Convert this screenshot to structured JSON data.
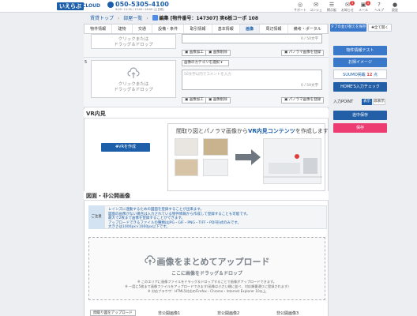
{
  "header": {
    "logo": "いえらぶ",
    "logo_sub": "CLOUD",
    "phone": "050-5305-4100",
    "phone_hours": "9:00~11:30 / 13:00~18:00 (土日祝)",
    "icons": [
      {
        "name": "support-icon",
        "label": "サポート",
        "glyph": "◎"
      },
      {
        "name": "concierge-icon",
        "label": "コンシェ",
        "glyph": "✉"
      },
      {
        "name": "forum-icon",
        "label": "掲示板",
        "glyph": "☰"
      },
      {
        "name": "notice-icon",
        "label": "お知らせ",
        "glyph": "✉",
        "badge": "1"
      },
      {
        "name": "mail-icon",
        "label": "メール",
        "glyph": "▣",
        "badge": "1"
      },
      {
        "name": "help-icon",
        "label": "ヘルプ",
        "glyph": "?"
      },
      {
        "name": "user-icon",
        "label": "設定",
        "glyph": "●"
      }
    ]
  },
  "breadcrumb": {
    "items": [
      "賃貸トップ",
      "部屋一覧"
    ],
    "current": "編集 [物件番号：147307] 実6板コーポ 108"
  },
  "tabs": [
    "物件情報",
    "建物",
    "交通",
    "設備・条件",
    "取引情報",
    "基本情報",
    "画像",
    "周辺情報",
    "備考・ポータル"
  ],
  "active_tab": "画像",
  "upload_rows": {
    "row4_hint": "クリックまたは\nドラッグ＆ドロップ",
    "row4_count": "0 / 50文字",
    "row5_num": "5",
    "row5_hint": "クリックまたは\nドラッグ＆ドロップ",
    "category_placeholder": "画像のカテゴリを選択",
    "comment_placeholder": "50文字以内でコメントを入力",
    "row5_count": "0 / 50文字",
    "process_btn": "画像加工",
    "delete_btn": "画像削除",
    "panorama_btn": "パノラマ画像を",
    "panorama_btn_suffix": "登録"
  },
  "vr": {
    "title": "VR内見",
    "create_btn": "VRを作成",
    "banner_prefix": "間取り図とパノラマ画像から",
    "banner_strong": "VR内見コンテンツ",
    "banner_suffix": "を作成します"
  },
  "floorplan": {
    "title": "図面・非公開画像",
    "note_tag": "ご注意",
    "notes": [
      "レインズに連動するための図面を登録することが出来ます。",
      "図面の画像がない場合は入力されている物件情報から作成して登録することも可能です。",
      "最大で2枚まで画像を登録することができます。",
      "アップロードできるファイルの種類はJPG・GIF・PNG・TIFF・PDF形式のみです。",
      "大きさは1000px×1000px以下です。"
    ],
    "bulk_title": "画像をまとめてアップロード",
    "bulk_sub": "ここに画像をドラッグ＆ドロップ",
    "bulk_notes": [
      "※ このエリアに画像ファイルをドラッグ＆ドロップすることで画像がアップロードできます。",
      "※ 一度に5枚まで画像ファイルをアップロードできます(画像は小さい順に並べ、対応順番通りに登録されます)",
      "※ 対応ブラウザ：HTML5対応のFirefox・Chrome・Internet Explorer 10以上"
    ],
    "bottom_btn": "間取り図をアップロード",
    "captions": [
      "非公開画像1",
      "非公開画像2",
      "非公開画像3"
    ]
  },
  "sidebar": {
    "top_btn1": "タブの並び替えを保存",
    "top_btn2": "全て開く",
    "buttons": [
      "物件情報テスト",
      "お掃イメージ"
    ],
    "suumo_label": "SUUMO掲載",
    "suumo_count": "12",
    "suumo_unit": "点",
    "homes_btn": "HOME'S入力チェック",
    "point_label": "入力POINT",
    "point_on": "表示",
    "point_off": "非表示",
    "save_draft": "途中保存",
    "save": "保存"
  },
  "colors": {
    "accent": "#1d5fa8",
    "pink": "#ec3c72",
    "red_badge": "#e23b3b"
  }
}
